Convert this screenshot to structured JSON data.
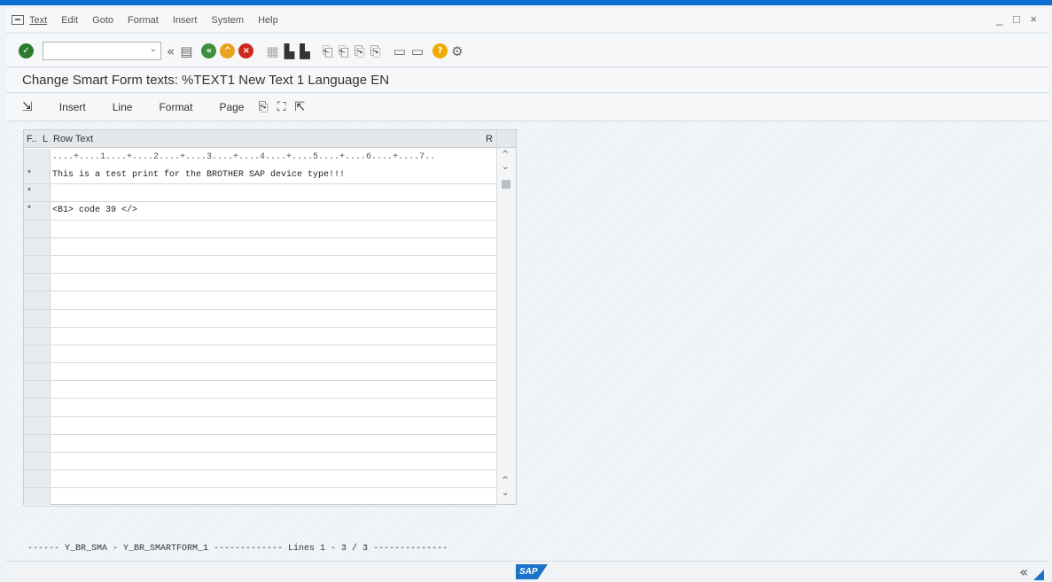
{
  "menu": {
    "items": [
      "Text",
      "Edit",
      "Goto",
      "Format",
      "Insert",
      "System",
      "Help"
    ]
  },
  "window_controls": "_ □ ×",
  "toolbar": {
    "command_field": {
      "value": "",
      "placeholder": ""
    },
    "icons": [
      "enter-icon",
      "back-nav-icon",
      "save-icon",
      "back-icon",
      "exit-icon",
      "cancel-icon",
      "print-icon",
      "find-icon",
      "find-next-icon",
      "first-page-icon",
      "previous-page-icon",
      "next-page-icon",
      "last-page-icon",
      "new-session-icon",
      "shortcut-icon",
      "help-icon",
      "customize-icon"
    ]
  },
  "title": "Change Smart Form texts: %TEXT1 New Text 1 Language EN",
  "app_toolbar": {
    "insert": "Insert",
    "line": "Line",
    "format": "Format",
    "page": "Page"
  },
  "editor": {
    "col_format": "F..",
    "col_line": "L",
    "col_text": "Row Text",
    "col_r": "R",
    "ruler": "....+....1....+....2....+....3....+....4....+....5....+....6....+....7..",
    "rows": [
      {
        "fmt": "*",
        "text": "This is a test print for the BROTHER SAP device type!!!"
      },
      {
        "fmt": "*",
        "text": ""
      },
      {
        "fmt": "*",
        "text": "<B1> code 39 </>"
      },
      {
        "fmt": "",
        "text": ""
      },
      {
        "fmt": "",
        "text": ""
      },
      {
        "fmt": "",
        "text": ""
      },
      {
        "fmt": "",
        "text": ""
      },
      {
        "fmt": "",
        "text": ""
      },
      {
        "fmt": "",
        "text": ""
      },
      {
        "fmt": "",
        "text": ""
      },
      {
        "fmt": "",
        "text": ""
      },
      {
        "fmt": "",
        "text": ""
      },
      {
        "fmt": "",
        "text": ""
      },
      {
        "fmt": "",
        "text": ""
      },
      {
        "fmt": "",
        "text": ""
      },
      {
        "fmt": "",
        "text": ""
      },
      {
        "fmt": "",
        "text": ""
      },
      {
        "fmt": "",
        "text": ""
      },
      {
        "fmt": "",
        "text": ""
      }
    ]
  },
  "status_line": "------ Y_BR_SMA - Y_BR_SMARTFORM_1 ------------- Lines 1 - 3 / 3 --------------",
  "footer": {
    "logo": "SAP",
    "collapse": "«"
  },
  "colors": {
    "ok_green": "#2b7d2b",
    "nav_green": "#3f8f3f",
    "exit_orange": "#e8a21c",
    "cancel_red": "#d0271d",
    "help_yellow": "#f0ab00",
    "sap_blue": "#1a73c8"
  }
}
